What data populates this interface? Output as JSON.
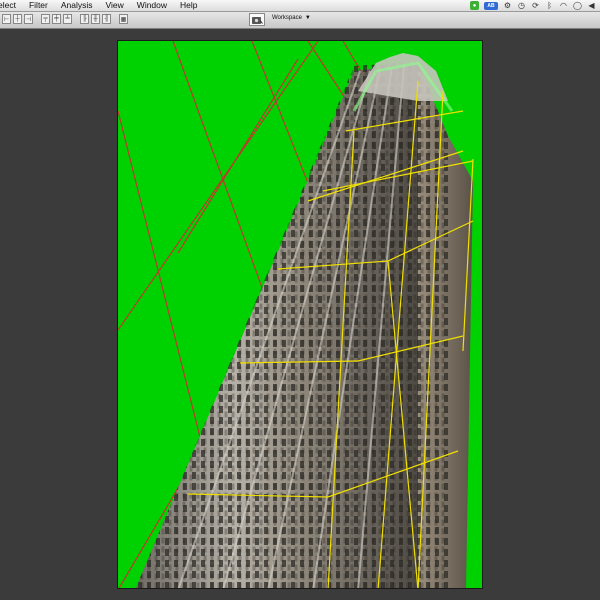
{
  "menu": {
    "items": [
      "elect",
      "Filter",
      "Analysis",
      "View",
      "Window",
      "Help"
    ]
  },
  "menu_extras": {
    "icons": [
      "evernote-icon",
      "badge-icon",
      "gear-icon",
      "time-machine-icon",
      "sync-icon",
      "bluetooth-icon",
      "wifi-icon",
      "chat-icon",
      "volume-icon"
    ],
    "badge_text": "AB"
  },
  "toolbar": {
    "workspace_label": "Workspace",
    "workspace_caret": "▼"
  },
  "colors": {
    "background": "#00d100",
    "perspective_grid": "#c0392b",
    "mesh": "#f0e000"
  }
}
